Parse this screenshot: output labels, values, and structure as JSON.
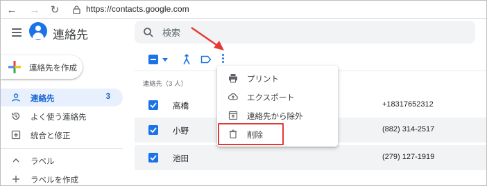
{
  "browser": {
    "url": "https://contacts.google.com",
    "back_icon": "arrow-left-icon",
    "forward_icon": "arrow-right-icon",
    "reload_icon": "reload-icon"
  },
  "app": {
    "title": "連絡先",
    "brand_color": "#1a73e8"
  },
  "search": {
    "placeholder": "検索",
    "value": ""
  },
  "create_button": {
    "label": "連絡先を作成"
  },
  "sidebar": {
    "items": [
      {
        "label": "連絡先",
        "count": "3",
        "icon": "person-icon",
        "active": true
      },
      {
        "label": "よく使う連絡先",
        "icon": "history-icon"
      },
      {
        "label": "統合と修正",
        "icon": "merge-fix-icon"
      },
      {
        "label": "ラベル",
        "icon": "chevron-up-icon"
      },
      {
        "label": "ラベルを作成",
        "icon": "plus-icon"
      }
    ]
  },
  "list": {
    "section_header": "連絡先（3 人）",
    "contacts": [
      {
        "name": "高橋",
        "phone": "+18317652312",
        "checked": true
      },
      {
        "name": "小野",
        "phone": "(882) 314-2517",
        "checked": true
      },
      {
        "name": "池田",
        "phone": "(279) 127-1919",
        "checked": true
      }
    ]
  },
  "menu": {
    "items": [
      {
        "label": "プリント",
        "icon": "print-icon"
      },
      {
        "label": "エクスポート",
        "icon": "cloud-upload-icon"
      },
      {
        "label": "連絡先から除外",
        "icon": "archive-icon"
      },
      {
        "label": "削除",
        "icon": "trash-icon",
        "highlighted": true
      }
    ]
  },
  "annotation": {
    "arrow_color": "#e53935",
    "highlight_color": "#e53935"
  }
}
